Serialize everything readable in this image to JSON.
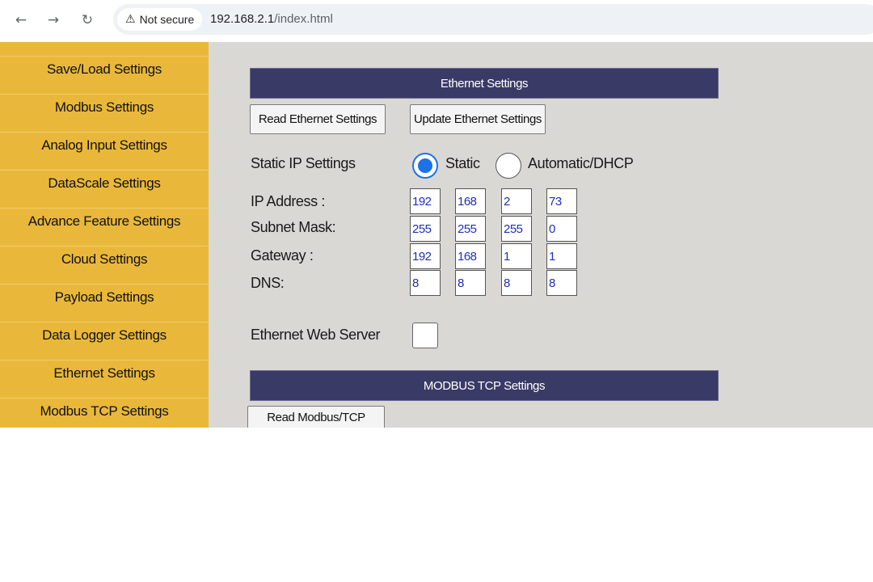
{
  "browser": {
    "security_label": "Not secure",
    "url_host": "192.168.2.1",
    "url_path": "/index.html"
  },
  "sidebar": {
    "items": [
      {
        "label": "Save/Load Settings"
      },
      {
        "label": "Modbus Settings"
      },
      {
        "label": "Analog Input Settings"
      },
      {
        "label": "DataScale Settings"
      },
      {
        "label": "Advance Feature Settings"
      },
      {
        "label": "Cloud Settings"
      },
      {
        "label": "Payload Settings"
      },
      {
        "label": "Data Logger Settings"
      },
      {
        "label": "Ethernet Settings"
      },
      {
        "label": "Modbus TCP Settings"
      }
    ]
  },
  "ethernet": {
    "title": "Ethernet Settings",
    "read_button": "Read Ethernet Settings",
    "update_button": "Update Ethernet Settings",
    "static_ip_label": "Static IP Settings",
    "radio_static": "Static",
    "radio_dhcp": "Automatic/DHCP",
    "mode_selected": "Static",
    "ip_label": "IP Address :",
    "subnet_label": "Subnet Mask:",
    "gateway_label": "Gateway :",
    "dns_label": "DNS:",
    "ip": [
      "192",
      "168",
      "2",
      "73"
    ],
    "subnet": [
      "255",
      "255",
      "255",
      "0"
    ],
    "gateway": [
      "192",
      "168",
      "1",
      "1"
    ],
    "dns": [
      "8",
      "8",
      "8",
      "8"
    ],
    "web_server_label": "Ethernet Web Server",
    "web_server_enabled": false
  },
  "modbus_tcp": {
    "title": "MODBUS TCP Settings",
    "read_button": "Read Modbus/TCP Settings"
  },
  "colors": {
    "sidebar_bg": "#e9b83b",
    "section_bar_bg": "#3a3a66",
    "content_bg": "#d9d8d5",
    "input_text": "#1f2fb8",
    "radio_accent": "#1a73e8"
  }
}
